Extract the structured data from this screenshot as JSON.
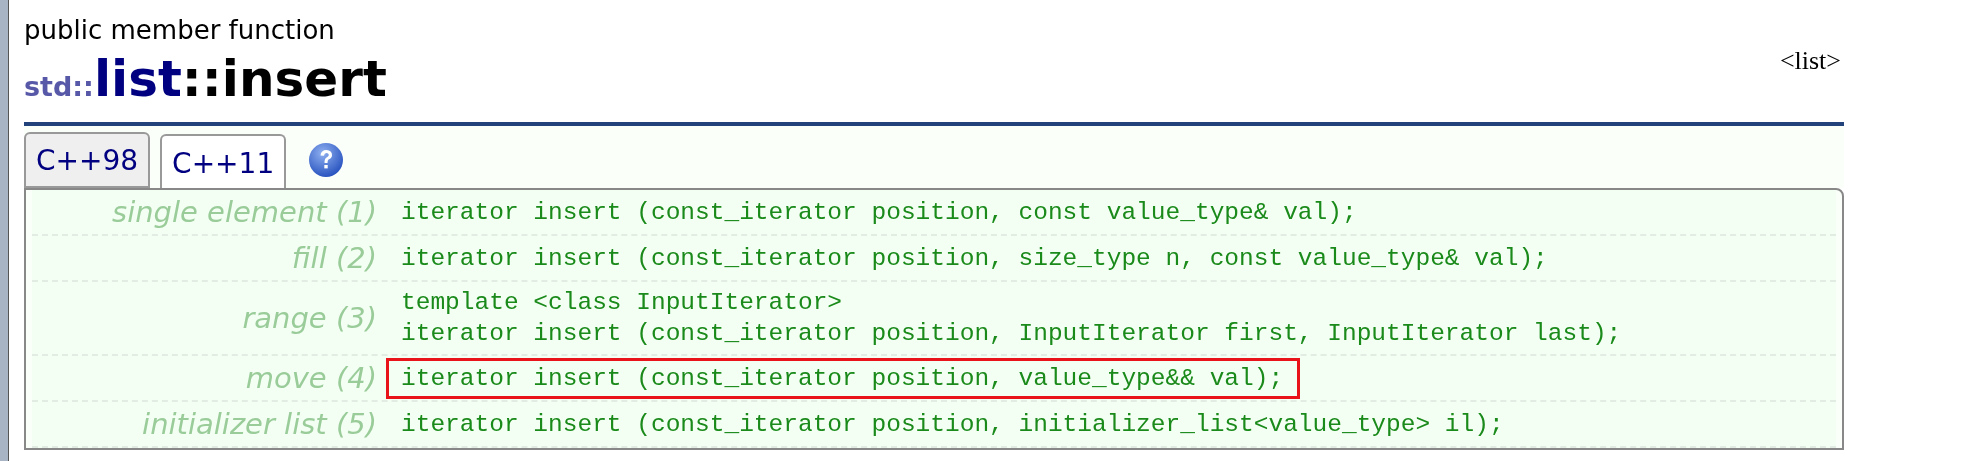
{
  "header": {
    "category": "public member function",
    "namespace": "std::",
    "class_name": "list",
    "member": "::insert",
    "header_file": "<list>"
  },
  "tabs": [
    {
      "label": "C++98",
      "selected": false
    },
    {
      "label": "C++11",
      "selected": true
    }
  ],
  "overloads": [
    {
      "label": "single element (1)",
      "lines": [
        "iterator insert (const_iterator position, const value_type& val);"
      ],
      "highlighted": false
    },
    {
      "label": "fill (2)",
      "lines": [
        "iterator insert (const_iterator position, size_type n, const value_type& val);"
      ],
      "highlighted": false
    },
    {
      "label": "range (3)",
      "lines": [
        "template <class InputIterator>",
        "iterator insert (const_iterator position, InputIterator first, InputIterator last);"
      ],
      "highlighted": false
    },
    {
      "label": "move (4)",
      "lines": [
        "iterator insert (const_iterator position, value_type&& val);"
      ],
      "highlighted": true
    },
    {
      "label": "initializer list (5)",
      "lines": [
        "iterator insert (const_iterator position, initializer_list<value_type> il);"
      ],
      "highlighted": false
    }
  ]
}
